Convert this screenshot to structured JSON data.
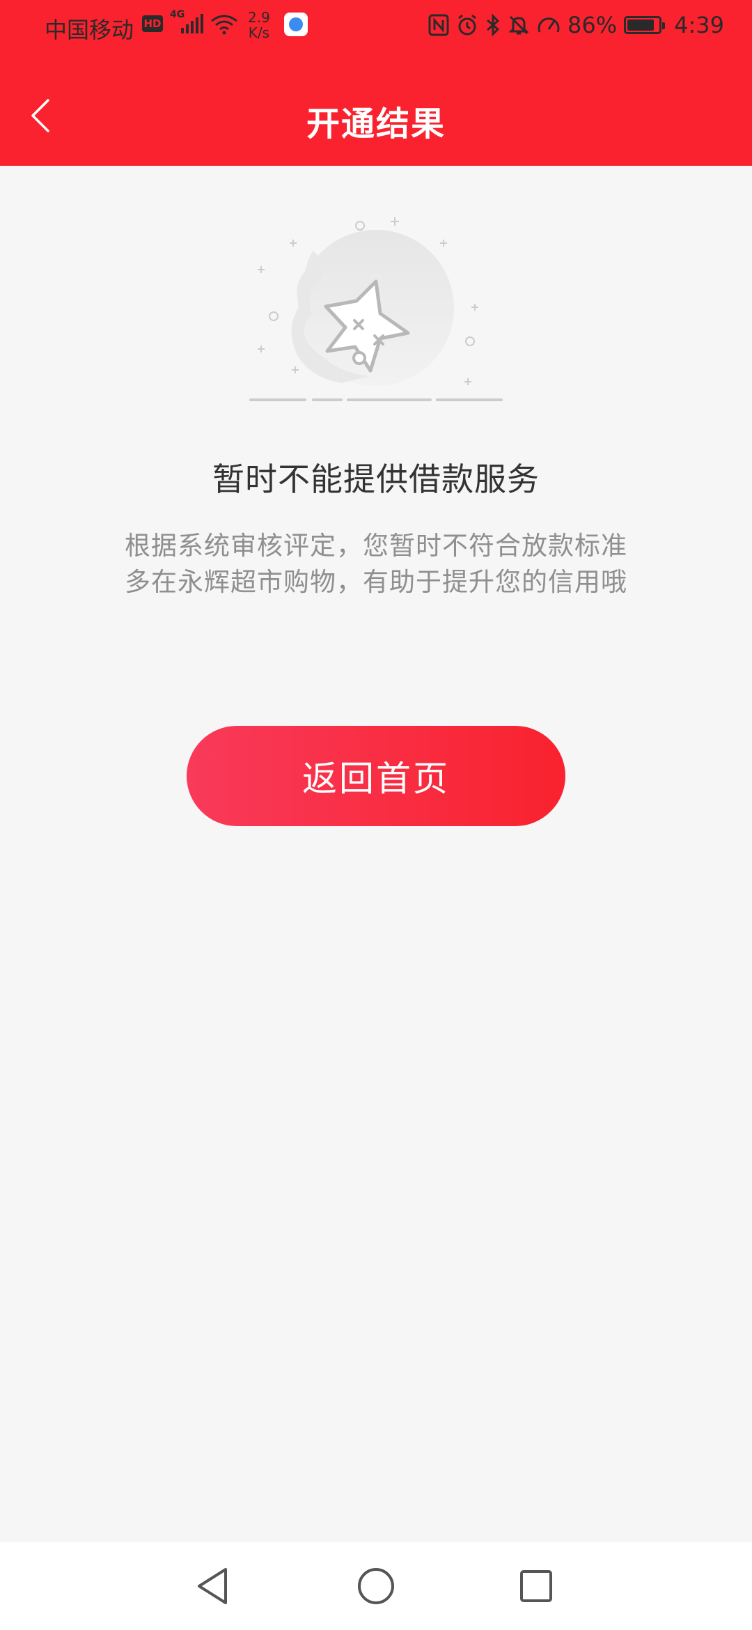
{
  "status_bar": {
    "carrier": "中国移动",
    "hd_badge": "HD",
    "network_type": "4G",
    "speed_value": "2.9",
    "speed_unit": "K/s",
    "battery": "86%",
    "battery_level": 0.86,
    "time": "4:39",
    "icons": [
      "hd-icon",
      "signal-icon",
      "wifi-icon",
      "app-notification-icon",
      "nfc-icon",
      "alarm-icon",
      "bluetooth-icon",
      "mute-icon",
      "speed-meter-icon",
      "battery-icon"
    ]
  },
  "header": {
    "title": "开通结果",
    "back_icon": "chevron-left-icon",
    "background_color": "#f9222e"
  },
  "result": {
    "illustration": "sad-star-illustration",
    "title": "暂时不能提供借款服务",
    "desc_line1": "根据系统审核评定，您暂时不符合放款标准",
    "desc_line2": "多在永辉超市购物，有助于提升您的信用哦"
  },
  "actions": {
    "home_button_label": "返回首页"
  },
  "system_nav": {
    "icons": [
      "back-triangle-icon",
      "home-circle-icon",
      "recents-square-icon"
    ]
  }
}
